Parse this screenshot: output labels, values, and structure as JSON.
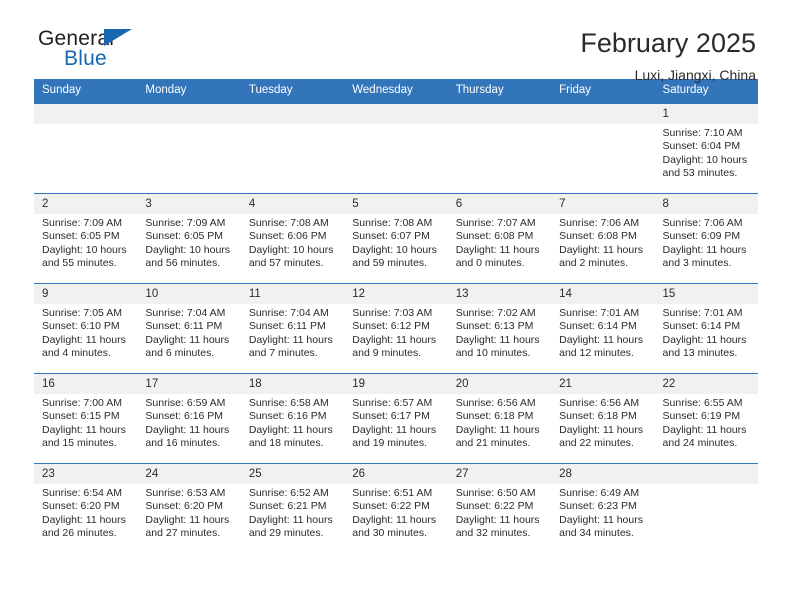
{
  "brand": {
    "name_part1": "General",
    "name_part2": "Blue",
    "flag_icon": "blue-triangle-flag-icon"
  },
  "header": {
    "title": "February 2025",
    "location": "Luxi, Jiangxi, China"
  },
  "calendar": {
    "accent_color": "#3275bb",
    "daynum_bg": "#f1f1f1",
    "weekday_headers": [
      "Sunday",
      "Monday",
      "Tuesday",
      "Wednesday",
      "Thursday",
      "Friday",
      "Saturday"
    ],
    "weeks": [
      [
        {
          "day": "",
          "empty": true
        },
        {
          "day": "",
          "empty": true
        },
        {
          "day": "",
          "empty": true
        },
        {
          "day": "",
          "empty": true
        },
        {
          "day": "",
          "empty": true
        },
        {
          "day": "",
          "empty": true
        },
        {
          "day": "1",
          "sunrise": "Sunrise: 7:10 AM",
          "sunset": "Sunset: 6:04 PM",
          "daylight": "Daylight: 10 hours and 53 minutes."
        }
      ],
      [
        {
          "day": "2",
          "sunrise": "Sunrise: 7:09 AM",
          "sunset": "Sunset: 6:05 PM",
          "daylight": "Daylight: 10 hours and 55 minutes."
        },
        {
          "day": "3",
          "sunrise": "Sunrise: 7:09 AM",
          "sunset": "Sunset: 6:05 PM",
          "daylight": "Daylight: 10 hours and 56 minutes."
        },
        {
          "day": "4",
          "sunrise": "Sunrise: 7:08 AM",
          "sunset": "Sunset: 6:06 PM",
          "daylight": "Daylight: 10 hours and 57 minutes."
        },
        {
          "day": "5",
          "sunrise": "Sunrise: 7:08 AM",
          "sunset": "Sunset: 6:07 PM",
          "daylight": "Daylight: 10 hours and 59 minutes."
        },
        {
          "day": "6",
          "sunrise": "Sunrise: 7:07 AM",
          "sunset": "Sunset: 6:08 PM",
          "daylight": "Daylight: 11 hours and 0 minutes."
        },
        {
          "day": "7",
          "sunrise": "Sunrise: 7:06 AM",
          "sunset": "Sunset: 6:08 PM",
          "daylight": "Daylight: 11 hours and 2 minutes."
        },
        {
          "day": "8",
          "sunrise": "Sunrise: 7:06 AM",
          "sunset": "Sunset: 6:09 PM",
          "daylight": "Daylight: 11 hours and 3 minutes."
        }
      ],
      [
        {
          "day": "9",
          "sunrise": "Sunrise: 7:05 AM",
          "sunset": "Sunset: 6:10 PM",
          "daylight": "Daylight: 11 hours and 4 minutes."
        },
        {
          "day": "10",
          "sunrise": "Sunrise: 7:04 AM",
          "sunset": "Sunset: 6:11 PM",
          "daylight": "Daylight: 11 hours and 6 minutes."
        },
        {
          "day": "11",
          "sunrise": "Sunrise: 7:04 AM",
          "sunset": "Sunset: 6:11 PM",
          "daylight": "Daylight: 11 hours and 7 minutes."
        },
        {
          "day": "12",
          "sunrise": "Sunrise: 7:03 AM",
          "sunset": "Sunset: 6:12 PM",
          "daylight": "Daylight: 11 hours and 9 minutes."
        },
        {
          "day": "13",
          "sunrise": "Sunrise: 7:02 AM",
          "sunset": "Sunset: 6:13 PM",
          "daylight": "Daylight: 11 hours and 10 minutes."
        },
        {
          "day": "14",
          "sunrise": "Sunrise: 7:01 AM",
          "sunset": "Sunset: 6:14 PM",
          "daylight": "Daylight: 11 hours and 12 minutes."
        },
        {
          "day": "15",
          "sunrise": "Sunrise: 7:01 AM",
          "sunset": "Sunset: 6:14 PM",
          "daylight": "Daylight: 11 hours and 13 minutes."
        }
      ],
      [
        {
          "day": "16",
          "sunrise": "Sunrise: 7:00 AM",
          "sunset": "Sunset: 6:15 PM",
          "daylight": "Daylight: 11 hours and 15 minutes."
        },
        {
          "day": "17",
          "sunrise": "Sunrise: 6:59 AM",
          "sunset": "Sunset: 6:16 PM",
          "daylight": "Daylight: 11 hours and 16 minutes."
        },
        {
          "day": "18",
          "sunrise": "Sunrise: 6:58 AM",
          "sunset": "Sunset: 6:16 PM",
          "daylight": "Daylight: 11 hours and 18 minutes."
        },
        {
          "day": "19",
          "sunrise": "Sunrise: 6:57 AM",
          "sunset": "Sunset: 6:17 PM",
          "daylight": "Daylight: 11 hours and 19 minutes."
        },
        {
          "day": "20",
          "sunrise": "Sunrise: 6:56 AM",
          "sunset": "Sunset: 6:18 PM",
          "daylight": "Daylight: 11 hours and 21 minutes."
        },
        {
          "day": "21",
          "sunrise": "Sunrise: 6:56 AM",
          "sunset": "Sunset: 6:18 PM",
          "daylight": "Daylight: 11 hours and 22 minutes."
        },
        {
          "day": "22",
          "sunrise": "Sunrise: 6:55 AM",
          "sunset": "Sunset: 6:19 PM",
          "daylight": "Daylight: 11 hours and 24 minutes."
        }
      ],
      [
        {
          "day": "23",
          "sunrise": "Sunrise: 6:54 AM",
          "sunset": "Sunset: 6:20 PM",
          "daylight": "Daylight: 11 hours and 26 minutes."
        },
        {
          "day": "24",
          "sunrise": "Sunrise: 6:53 AM",
          "sunset": "Sunset: 6:20 PM",
          "daylight": "Daylight: 11 hours and 27 minutes."
        },
        {
          "day": "25",
          "sunrise": "Sunrise: 6:52 AM",
          "sunset": "Sunset: 6:21 PM",
          "daylight": "Daylight: 11 hours and 29 minutes."
        },
        {
          "day": "26",
          "sunrise": "Sunrise: 6:51 AM",
          "sunset": "Sunset: 6:22 PM",
          "daylight": "Daylight: 11 hours and 30 minutes."
        },
        {
          "day": "27",
          "sunrise": "Sunrise: 6:50 AM",
          "sunset": "Sunset: 6:22 PM",
          "daylight": "Daylight: 11 hours and 32 minutes."
        },
        {
          "day": "28",
          "sunrise": "Sunrise: 6:49 AM",
          "sunset": "Sunset: 6:23 PM",
          "daylight": "Daylight: 11 hours and 34 minutes."
        },
        {
          "day": "",
          "empty": true
        }
      ]
    ]
  }
}
